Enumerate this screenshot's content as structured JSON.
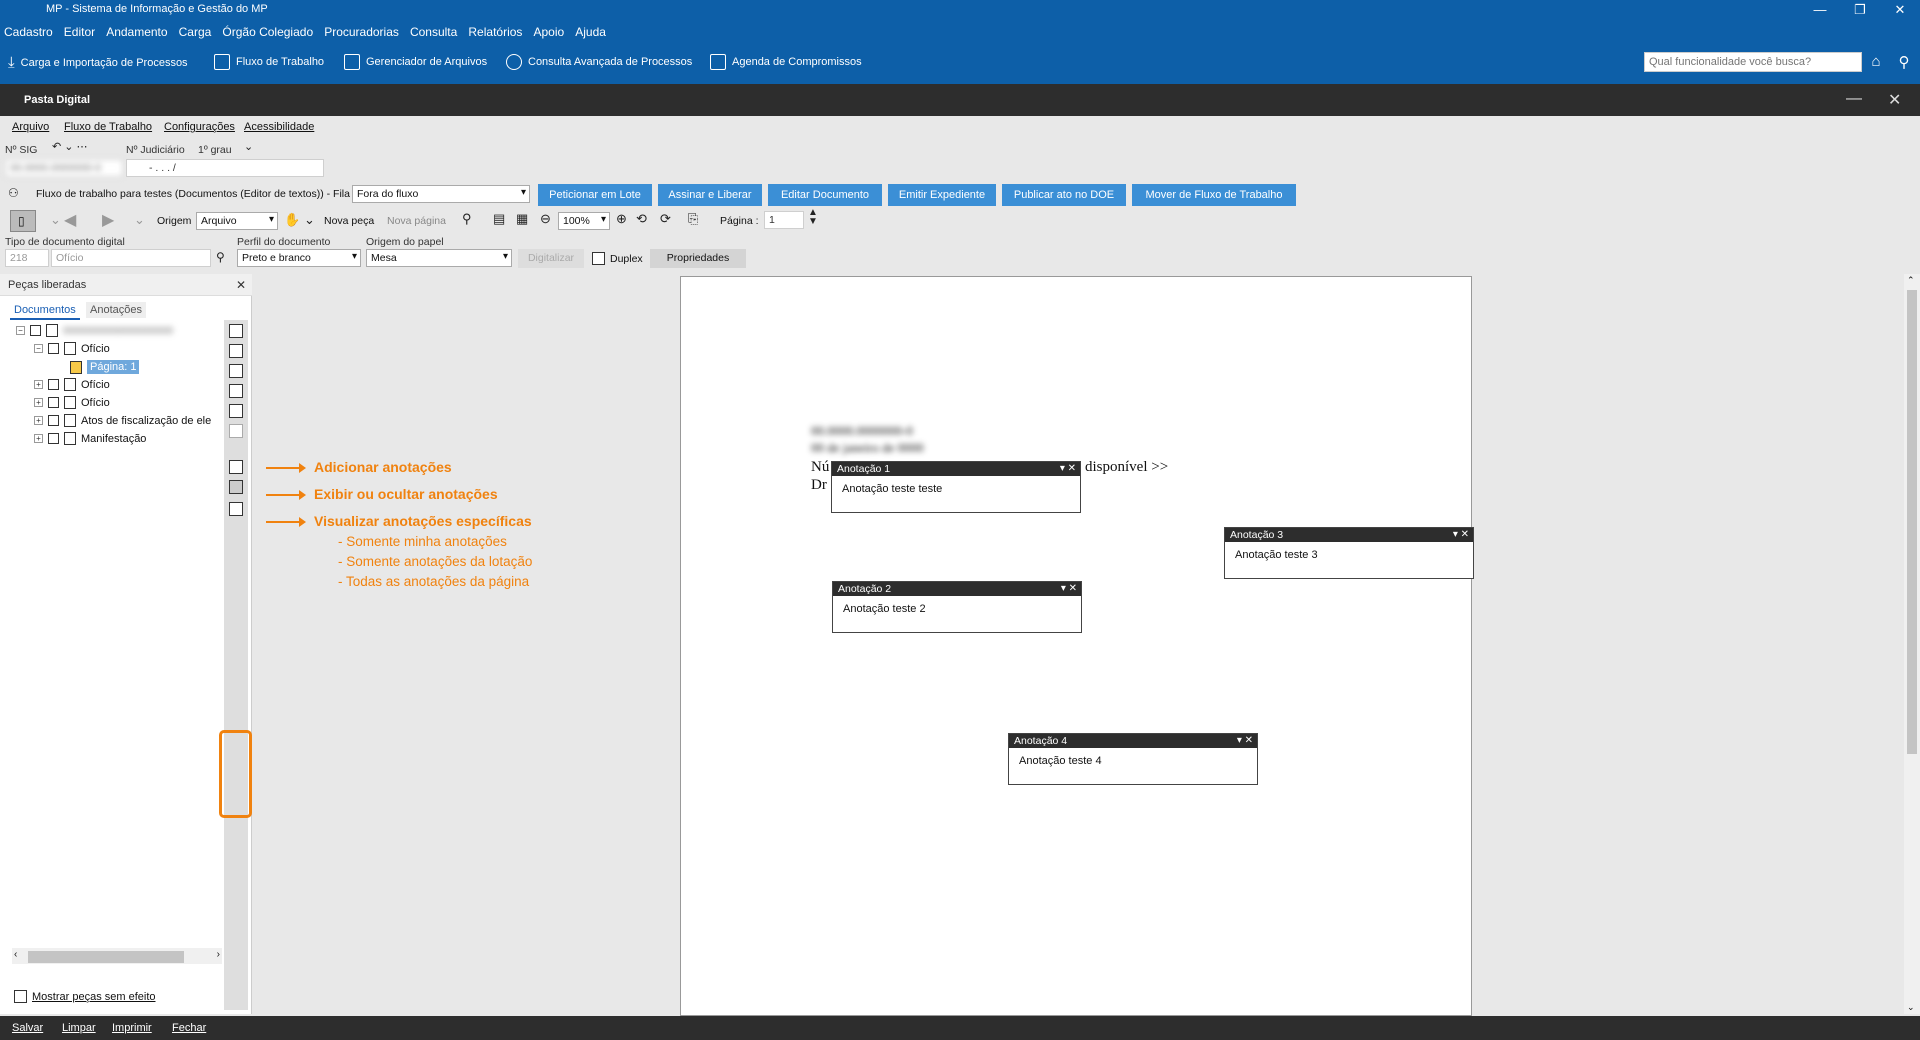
{
  "window": {
    "title": "MP - Sistema de Informação e Gestão do MP"
  },
  "menubar": [
    "Cadastro",
    "Editor",
    "Andamento",
    "Carga",
    "Órgão Colegiado",
    "Procuradorias",
    "Consulta",
    "Relatórios",
    "Apoio",
    "Ajuda"
  ],
  "toolbar": {
    "items": [
      "Carga e Importação de Processos",
      "Fluxo de Trabalho",
      "Gerenciador de Arquivos",
      "Consulta Avançada de Processos",
      "Agenda de Compromissos"
    ],
    "search_placeholder": "Qual funcionalidade você busca?"
  },
  "pasta": {
    "title": "Pasta Digital",
    "menu": [
      "Arquivo",
      "Fluxo de Trabalho",
      "Configurações",
      "Acessibilidade"
    ],
    "nsig_label": "Nº SIG",
    "njud_label": "Nº Judiciário",
    "grau": "1º grau",
    "njud_value": "- .  . . /",
    "fluxo_text": "Fluxo de trabalho para testes (Documentos (Editor de textos)) - Fila",
    "fila_value": "Fora do fluxo",
    "buttons": [
      "Peticionar em Lote",
      "Assinar e Liberar",
      "Editar Documento",
      "Emitir Expediente",
      "Publicar ato no DOE",
      "Mover de Fluxo de Trabalho"
    ],
    "origem_label": "Origem",
    "origem_value": "Arquivo",
    "nova_peca": "Nova peça",
    "nova_pagina": "Nova página",
    "zoom": "100%",
    "pagina_label": "Página :",
    "pagina_value": "1",
    "tipo_label": "Tipo de documento digital",
    "tipo_code": "218",
    "tipo_value": "Ofício",
    "perfil_label": "Perfil do documento",
    "perfil_value": "Preto e branco",
    "origem_papel_label": "Origem do papel",
    "origem_papel_value": "Mesa",
    "digitalizar": "Digitalizar",
    "duplex": "Duplex",
    "propriedades": "Propriedades"
  },
  "leftpanel": {
    "header": "Peças liberadas",
    "tabs": [
      "Documentos",
      "Anotações"
    ],
    "tree": [
      "Ofício",
      "Página: 1",
      "Ofício",
      "Ofício",
      "Atos de fiscalização de ele",
      "Manifestação"
    ],
    "mostrar": "Mostrar peças sem efeito"
  },
  "callouts": {
    "add": "Adicionar anotações",
    "toggle": "Exibir ou ocultar anotações",
    "view": "Visualizar anotações específicas",
    "sub": [
      "- Somente minha anotações",
      "- Somente anotações da lotação",
      "- Todas as anotações da página"
    ]
  },
  "document": {
    "line1_prefix": "Nú",
    "line1_suffix": "disponível >>",
    "line2_prefix": "Dr"
  },
  "notes": [
    {
      "title": "Anotação 1",
      "text": "Anotação teste teste"
    },
    {
      "title": "Anotação 2",
      "text": "Anotação teste 2"
    },
    {
      "title": "Anotação 3",
      "text": "Anotação teste 3"
    },
    {
      "title": "Anotação 4",
      "text": "Anotação teste 4"
    }
  ],
  "bottombar": [
    "Salvar",
    "Limpar",
    "Imprimir",
    "Fechar"
  ],
  "colors": {
    "brand": "#0d5fa8",
    "accent_button": "#3b8fd6",
    "callout": "#f0820f",
    "dark": "#2d2d2d"
  }
}
